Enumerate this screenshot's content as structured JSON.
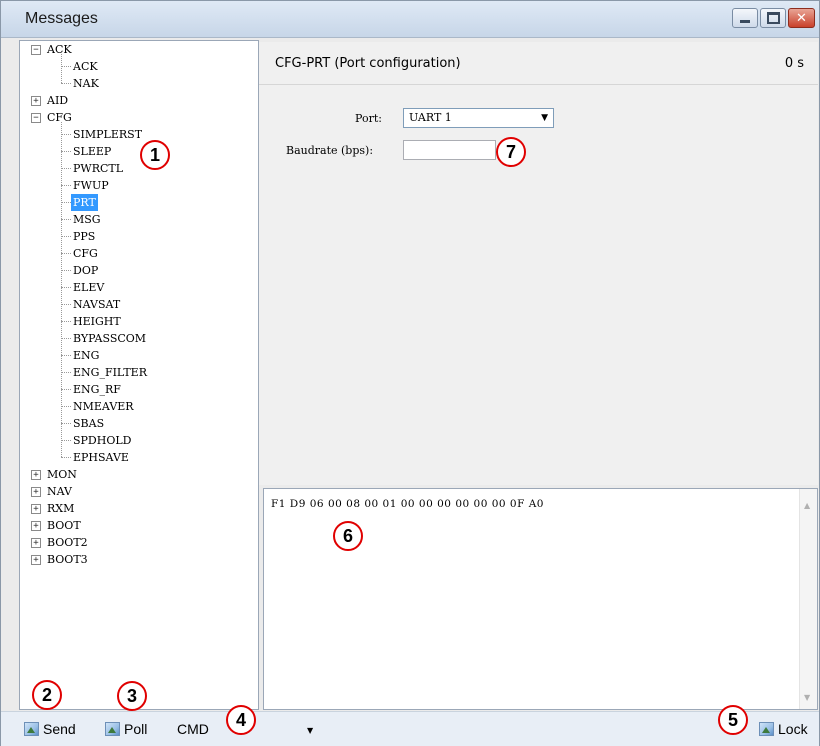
{
  "window": {
    "title": "Messages",
    "controls": {
      "minimize_icon": "minimize-icon",
      "maximize_icon": "maximize-icon",
      "close_icon": "close-icon",
      "close_glyph": "✕"
    }
  },
  "tree": {
    "groups": [
      {
        "label": "ACK",
        "expanded": true,
        "children": [
          "ACK",
          "NAK"
        ]
      },
      {
        "label": "AID",
        "expanded": false,
        "children": []
      },
      {
        "label": "CFG",
        "expanded": true,
        "children": [
          "SIMPLERST",
          "SLEEP",
          "PWRCTL",
          "FWUP",
          "PRT",
          "MSG",
          "PPS",
          "CFG",
          "DOP",
          "ELEV",
          "NAVSAT",
          "HEIGHT",
          "BYPASSCOM",
          "ENG",
          "ENG_FILTER",
          "ENG_RF",
          "NMEAVER",
          "SBAS",
          "SPDHOLD",
          "EPHSAVE"
        ]
      },
      {
        "label": "MON",
        "expanded": false,
        "children": []
      },
      {
        "label": "NAV",
        "expanded": false,
        "children": []
      },
      {
        "label": "RXM",
        "expanded": false,
        "children": []
      },
      {
        "label": "BOOT",
        "expanded": false,
        "children": []
      },
      {
        "label": "BOOT2",
        "expanded": false,
        "children": []
      },
      {
        "label": "BOOT3",
        "expanded": false,
        "children": []
      }
    ],
    "selected": "PRT",
    "expand_glyph": "+",
    "collapse_glyph": "−"
  },
  "message": {
    "title": "CFG-PRT (Port configuration)",
    "elapsed": "0 s"
  },
  "form": {
    "port_label": "Port:",
    "port_value": "UART 1",
    "port_arrow": "▼",
    "baudrate_label": "Baudrate (bps):",
    "baudrate_value": ""
  },
  "hex": {
    "text": "F1 D9 06 00 08 00 01 00 00 00 00 00 00 0F A0",
    "scroll_up": "▲",
    "scroll_down": "▼"
  },
  "statusbar": {
    "send_label": "Send",
    "poll_label": "Poll",
    "mode_value": "CMD",
    "mode_arrow": "▼",
    "lock_label": "Lock"
  },
  "annotations": [
    "1",
    "2",
    "3",
    "4",
    "5",
    "6",
    "7"
  ],
  "colors": {
    "selection": "#3399ff",
    "annotation_ring": "#e00000",
    "titlebar": "#c7d6e8"
  }
}
